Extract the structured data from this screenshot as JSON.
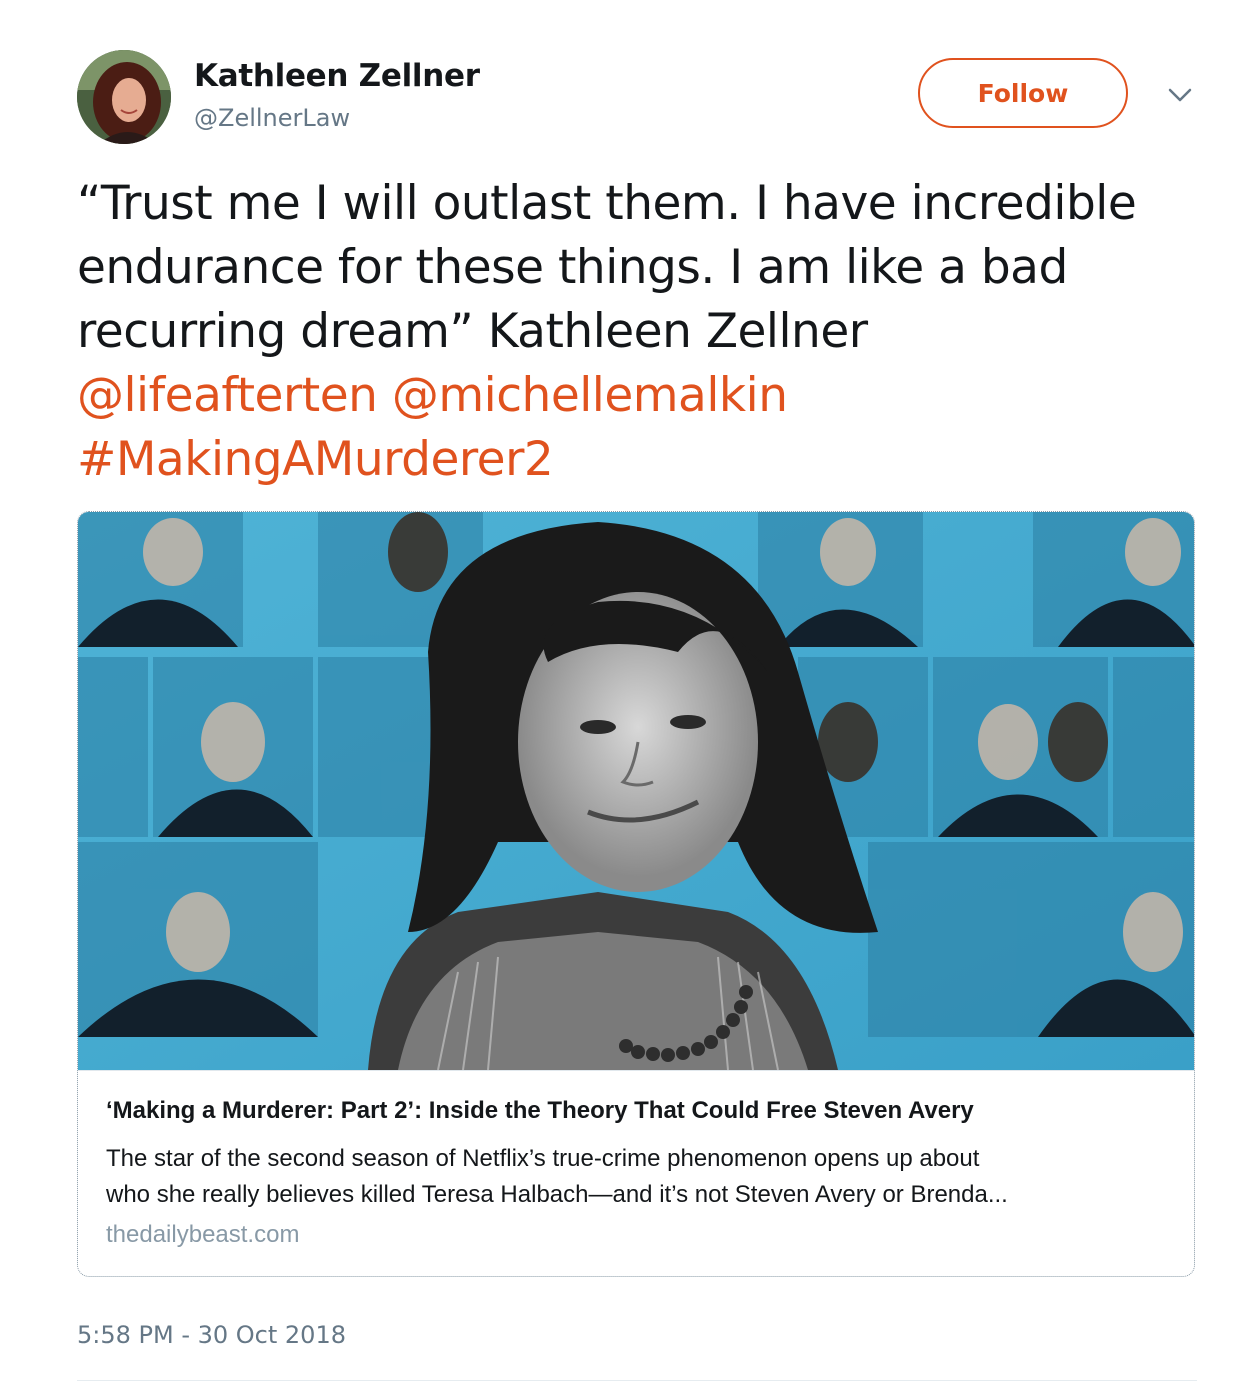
{
  "tweet": {
    "author_name": "Kathleen Zellner",
    "author_handle": "@ZellnerLaw",
    "follow_label": "Follow",
    "text_lines": [
      "“Trust me I will outlast them. I have incredible",
      "endurance for these things. I am like a bad",
      "recurring dream” Kathleen Zellner"
    ],
    "mentions": [
      "@lifeafterten",
      "@michellemalkin"
    ],
    "hashtag": "#MakingAMurderer2",
    "timestamp": "5:58 PM - 30 Oct 2018"
  },
  "card": {
    "title": "‘Making a Murderer: Part 2’: Inside the Theory That Could Free Steven Avery",
    "description_line1": "The star of the second season of Netflix’s true-crime phenomenon opens up about",
    "description_line2": "who she really believes killed Teresa Halbach—and it’s not Steven Avery or Brenda...",
    "domain": "thedailybeast.com"
  },
  "colors": {
    "accent": "#e0521e",
    "text": "#14171a",
    "muted": "#657786",
    "card_domain": "#8899a6"
  },
  "icons": {
    "dropdown": "chevron-down-icon"
  }
}
